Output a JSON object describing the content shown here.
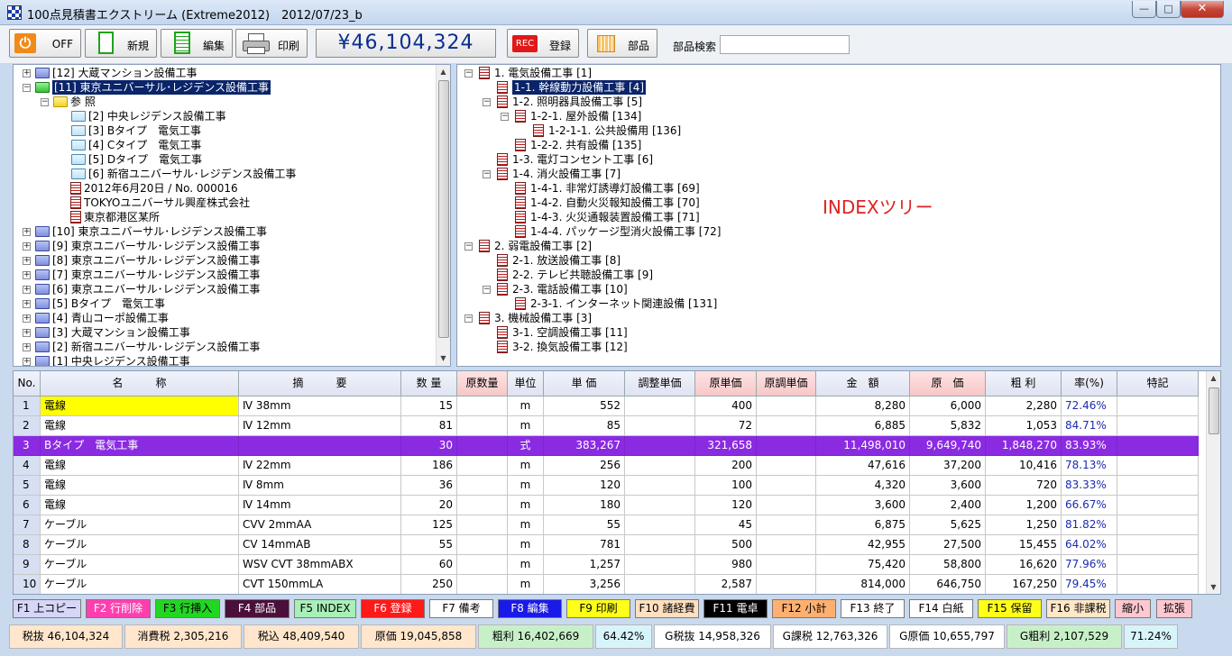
{
  "window": {
    "title": "100点見積書エクストリーム (Extreme2012)　2012/07/23_b",
    "minimize": "—",
    "maximize": "□",
    "close": "✕"
  },
  "toolbar": {
    "off": "OFF",
    "new": "新規",
    "edit": "編集",
    "print": "印刷",
    "total": "¥46,104,324",
    "rec_badge": "REC",
    "register": "登録",
    "parts": "部品",
    "search_label": "部品検索",
    "search_value": ""
  },
  "left_tree": [
    {
      "label": "[12] 大蔵マンション設備工事",
      "icon": "folder-icon"
    },
    {
      "label": "[11] 東京ユニバーサル･レジデンス設備工事",
      "icon": "folder-open-icon",
      "selected": true
    },
    {
      "label": "参 照",
      "icon": "folder-yellow-icon"
    },
    {
      "label": "[2] 中央レジデンス設備工事",
      "icon": "folder-light-icon"
    },
    {
      "label": "[3] Bタイプ　電気工事",
      "icon": "folder-light-icon"
    },
    {
      "label": "[4] Cタイプ　電気工事",
      "icon": "folder-light-icon"
    },
    {
      "label": "[5] Dタイプ　電気工事",
      "icon": "folder-light-icon"
    },
    {
      "label": "[6] 新宿ユニバーサル･レジデンス設備工事",
      "icon": "folder-light-icon"
    },
    {
      "label": "2012年6月20日 / No. 000016",
      "icon": "document-icon"
    },
    {
      "label": "TOKYOユニバーサル興産株式会社",
      "icon": "document-icon"
    },
    {
      "label": "東京都港区某所",
      "icon": "document-icon"
    },
    {
      "label": "[10] 東京ユニバーサル･レジデンス設備工事",
      "icon": "folder-icon"
    },
    {
      "label": "[9] 東京ユニバーサル･レジデンス設備工事",
      "icon": "folder-icon"
    },
    {
      "label": "[8] 東京ユニバーサル･レジデンス設備工事",
      "icon": "folder-icon"
    },
    {
      "label": "[7] 東京ユニバーサル･レジデンス設備工事",
      "icon": "folder-icon"
    },
    {
      "label": "[6] 東京ユニバーサル･レジデンス設備工事",
      "icon": "folder-icon"
    },
    {
      "label": "[5] Bタイプ　電気工事",
      "icon": "folder-icon"
    },
    {
      "label": "[4] 青山コーポ設備工事",
      "icon": "folder-icon"
    },
    {
      "label": "[3] 大蔵マンション設備工事",
      "icon": "folder-icon"
    },
    {
      "label": "[2] 新宿ユニバーサル･レジデンス設備工事",
      "icon": "folder-icon"
    },
    {
      "label": "[1] 中央レジデンス設備工事",
      "icon": "folder-icon"
    }
  ],
  "right_tree": [
    {
      "label": "1. 電気設備工事 [1]"
    },
    {
      "label": "1-1. 幹線動力設備工事 [4]",
      "selected": true
    },
    {
      "label": "1-2. 照明器具設備工事 [5]"
    },
    {
      "label": "1-2-1. 屋外設備 [134]"
    },
    {
      "label": "1-2-1-1. 公共設備用 [136]"
    },
    {
      "label": "1-2-2. 共有設備 [135]"
    },
    {
      "label": "1-3. 電灯コンセント工事 [6]"
    },
    {
      "label": "1-4. 消火設備工事 [7]"
    },
    {
      "label": "1-4-1. 非常灯誘導灯設備工事 [69]"
    },
    {
      "label": "1-4-2. 自動火災報知設備工事 [70]"
    },
    {
      "label": "1-4-3. 火災通報装置設備工事 [71]"
    },
    {
      "label": "1-4-4. パッケージ型消火設備工事 [72]"
    },
    {
      "label": "2. 弱電設備工事 [2]"
    },
    {
      "label": "2-1. 放送設備工事 [8]"
    },
    {
      "label": "2-2. テレビ共聴設備工事 [9]"
    },
    {
      "label": "2-3. 電話設備工事 [10]"
    },
    {
      "label": "2-3-1. インターネット関連設備 [131]"
    },
    {
      "label": "3. 機械設備工事 [3]"
    },
    {
      "label": "3-1. 空調設備工事 [11]"
    },
    {
      "label": "3-2. 換気設備工事 [12]"
    }
  ],
  "index_label": "INDEXツリー",
  "grid": {
    "headers": [
      "No.",
      "名　　　称",
      "摘　　　要",
      "数 量",
      "原数量",
      "単位",
      "単 価",
      "調整単価",
      "原単価",
      "原調単価",
      "金　額",
      "原　価",
      "粗 利",
      "率(%)",
      "特記"
    ],
    "rows": [
      [
        "1",
        "電線",
        "Ⅳ 38mm",
        "15",
        "",
        "m",
        "552",
        "",
        "400",
        "",
        "8,280",
        "6,000",
        "2,280",
        "72.46%",
        ""
      ],
      [
        "2",
        "電線",
        "Ⅳ 12mm",
        "81",
        "",
        "m",
        "85",
        "",
        "72",
        "",
        "6,885",
        "5,832",
        "1,053",
        "84.71%",
        ""
      ],
      [
        "3",
        "Bタイプ　電気工事",
        "",
        "30",
        "",
        "式",
        "383,267",
        "",
        "321,658",
        "",
        "11,498,010",
        "9,649,740",
        "1,848,270",
        "83.93%",
        ""
      ],
      [
        "4",
        "電線",
        "Ⅳ 22mm",
        "186",
        "",
        "m",
        "256",
        "",
        "200",
        "",
        "47,616",
        "37,200",
        "10,416",
        "78.13%",
        ""
      ],
      [
        "5",
        "電線",
        "Ⅳ 8mm",
        "36",
        "",
        "m",
        "120",
        "",
        "100",
        "",
        "4,320",
        "3,600",
        "720",
        "83.33%",
        ""
      ],
      [
        "6",
        "電線",
        "Ⅳ 14mm",
        "20",
        "",
        "m",
        "180",
        "",
        "120",
        "",
        "3,600",
        "2,400",
        "1,200",
        "66.67%",
        ""
      ],
      [
        "7",
        "ケーブル",
        "CVV 2mmAA",
        "125",
        "",
        "m",
        "55",
        "",
        "45",
        "",
        "6,875",
        "5,625",
        "1,250",
        "81.82%",
        ""
      ],
      [
        "8",
        "ケーブル",
        "CV 14mmAB",
        "55",
        "",
        "m",
        "781",
        "",
        "500",
        "",
        "42,955",
        "27,500",
        "15,455",
        "64.02%",
        ""
      ],
      [
        "9",
        "ケーブル",
        "WSV CVT 38mmABX",
        "60",
        "",
        "m",
        "1,257",
        "",
        "980",
        "",
        "75,420",
        "58,800",
        "16,620",
        "77.96%",
        ""
      ],
      [
        "10",
        "ケーブル",
        "CVT 150mmLA",
        "250",
        "",
        "m",
        "3,256",
        "",
        "2,587",
        "",
        "814,000",
        "646,750",
        "167,250",
        "79.45%",
        ""
      ]
    ]
  },
  "fkeys": [
    {
      "label": "F1 上コピー",
      "bg": "#d6d6f8",
      "fg": "#000"
    },
    {
      "label": "F2 行削除",
      "bg": "#ff3fb0",
      "fg": "#fff"
    },
    {
      "label": "F3 行挿入",
      "bg": "#22d622",
      "fg": "#000"
    },
    {
      "label": "F4 部品",
      "bg": "#4a0f3a",
      "fg": "#fff"
    },
    {
      "label": "F5 INDEX",
      "bg": "#a8f0b8",
      "fg": "#000"
    },
    {
      "label": "F6 登録",
      "bg": "#ff1a1a",
      "fg": "#fff"
    },
    {
      "label": "F7 備考",
      "bg": "#ffffff",
      "fg": "#000"
    },
    {
      "label": "F8 編集",
      "bg": "#1a1ae8",
      "fg": "#fff"
    },
    {
      "label": "F9 印刷",
      "bg": "#ffff1a",
      "fg": "#000"
    },
    {
      "label": "F10 諸経費",
      "bg": "#ffe0c0",
      "fg": "#000"
    },
    {
      "label": "F11 電卓",
      "bg": "#000000",
      "fg": "#fff"
    },
    {
      "label": "F12 小計",
      "bg": "#ffb070",
      "fg": "#000"
    },
    {
      "label": "F13 終了",
      "bg": "#ffffff",
      "fg": "#000"
    },
    {
      "label": "F14 白紙",
      "bg": "#ffffff",
      "fg": "#000"
    },
    {
      "label": "F15 保留",
      "bg": "#ffff1a",
      "fg": "#000"
    },
    {
      "label": "F16 非課税",
      "bg": "#ffe8c8",
      "fg": "#000"
    },
    {
      "label": "縮小",
      "bg": "#ffc8d0",
      "fg": "#000"
    },
    {
      "label": "拡張",
      "bg": "#ffc8d0",
      "fg": "#000"
    }
  ],
  "status": [
    {
      "label": "税抜 46,104,324",
      "bg": "#ffe6cc"
    },
    {
      "label": "消費税 2,305,216",
      "bg": "#ffe6cc"
    },
    {
      "label": "税込 48,409,540",
      "bg": "#ffe6cc"
    },
    {
      "label": "原価 19,045,858",
      "bg": "#ffe6cc"
    },
    {
      "label": "粗利 16,402,669",
      "bg": "#c8f0c8"
    },
    {
      "label": "64.42%",
      "bg": "#d8f4fb"
    },
    {
      "label": "G税抜 14,958,326",
      "bg": "#ffffff"
    },
    {
      "label": "G課税 12,763,326",
      "bg": "#ffffff"
    },
    {
      "label": "G原価 10,655,797",
      "bg": "#ffffff"
    },
    {
      "label": "G粗利 2,107,529",
      "bg": "#c8f0c8"
    },
    {
      "label": "71.24%",
      "bg": "#d8f4fb"
    }
  ]
}
